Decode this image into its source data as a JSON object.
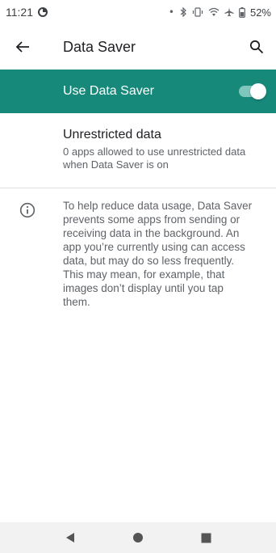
{
  "status_bar": {
    "time": "11:21",
    "battery": "52%",
    "icons": [
      "data-saver-status-icon",
      "dot-icon",
      "bluetooth-icon",
      "vibrate-icon",
      "wifi-icon",
      "airplane-icon",
      "battery-icon"
    ]
  },
  "app_bar": {
    "title": "Data Saver",
    "back_icon": "arrow-back-icon",
    "search_icon": "search-icon"
  },
  "master_switch": {
    "label": "Use Data Saver",
    "enabled": true,
    "background_color": "#16897a"
  },
  "unrestricted": {
    "title": "Unrestricted data",
    "summary": "0 apps allowed to use unrestricted data when Data Saver is on"
  },
  "footer": {
    "icon": "info-icon",
    "lines": [
      "To help reduce data usage, Data Saver",
      "prevents some apps from sending or",
      "receiving data in the background. An",
      "app you’re currently using can access",
      "data, but may do so less frequently.",
      "This may mean, for example, that",
      "images don’t display until you tap",
      "them."
    ]
  },
  "nav_bar": {
    "buttons": [
      "back-triangle-icon",
      "home-circle-icon",
      "recents-square-icon"
    ]
  }
}
